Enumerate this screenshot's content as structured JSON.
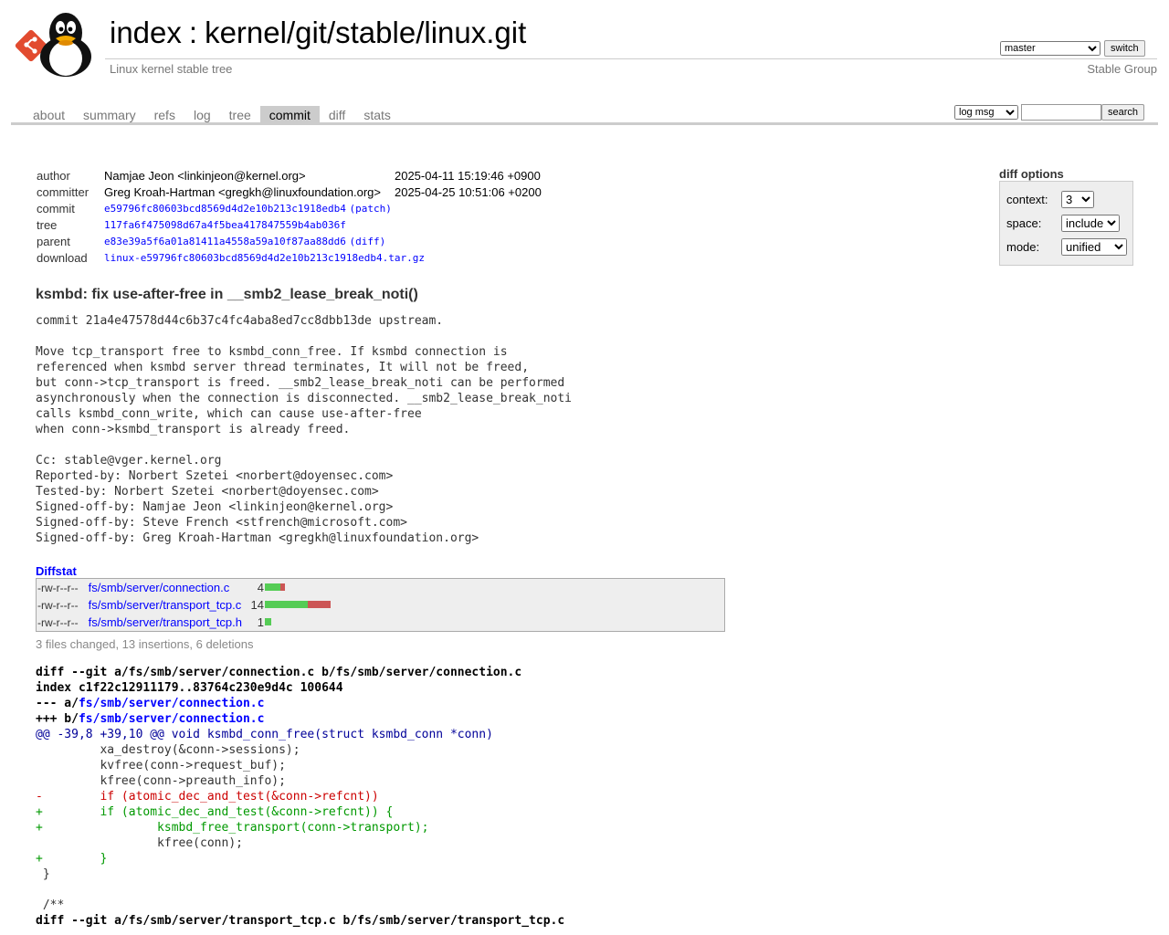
{
  "header": {
    "logo_icon": "cgit-penguin-logo",
    "title_prefix": "index",
    "title_separator": ":",
    "repo_path": "kernel/git/stable/linux.git",
    "description": "Linux kernel stable tree",
    "owner": "Stable Group",
    "branch": "master",
    "switch_label": "switch"
  },
  "tabs": [
    {
      "label": "about",
      "active": false
    },
    {
      "label": "summary",
      "active": false
    },
    {
      "label": "refs",
      "active": false
    },
    {
      "label": "log",
      "active": false
    },
    {
      "label": "tree",
      "active": false
    },
    {
      "label": "commit",
      "active": true
    },
    {
      "label": "diff",
      "active": false
    },
    {
      "label": "stats",
      "active": false
    }
  ],
  "search": {
    "scope": "log msg",
    "value": "",
    "button_label": "search"
  },
  "commit_info": {
    "author_label": "author",
    "author": "Namjae Jeon <linkinjeon@kernel.org>",
    "author_date": "2025-04-11 15:19:46 +0900",
    "committer_label": "committer",
    "committer": "Greg Kroah-Hartman <gregkh@linuxfoundation.org>",
    "committer_date": "2025-04-25 10:51:06 +0200",
    "commit_label": "commit",
    "commit_hash": "e59796fc80603bcd8569d4d2e10b213c1918edb4",
    "commit_link": "(patch)",
    "tree_label": "tree",
    "tree_hash": "117fa6f475098d67a4f5bea417847559b4ab036f",
    "parent_label": "parent",
    "parent_hash": "e83e39a5f6a01a81411a4558a59a10f87aa88dd6",
    "parent_link": "(diff)",
    "download_label": "download",
    "download_file": "linux-e59796fc80603bcd8569d4d2e10b213c1918edb4.tar.gz"
  },
  "diff_options": {
    "title": "diff options",
    "context_label": "context:",
    "context_value": "3",
    "space_label": "space:",
    "space_value": "include",
    "mode_label": "mode:",
    "mode_value": "unified"
  },
  "subject": "ksmbd: fix use-after-free in __smb2_lease_break_noti()",
  "message": "commit 21a4e47578d44c6b37c4fc4aba8ed7cc8dbb13de upstream.\n\nMove tcp_transport free to ksmbd_conn_free. If ksmbd connection is\nreferenced when ksmbd server thread terminates, It will not be freed,\nbut conn->tcp_transport is freed. __smb2_lease_break_noti can be performed\nasynchronously when the connection is disconnected. __smb2_lease_break_noti\ncalls ksmbd_conn_write, which can cause use-after-free\nwhen conn->ksmbd_transport is already freed.\n\nCc: stable@vger.kernel.org\nReported-by: Norbert Szetei <norbert@doyensec.com>\nTested-by: Norbert Szetei <norbert@doyensec.com>\nSigned-off-by: Namjae Jeon <linkinjeon@kernel.org>\nSigned-off-by: Steve French <stfrench@microsoft.com>\nSigned-off-by: Greg Kroah-Hartman <gregkh@linuxfoundation.org>",
  "diffstat": {
    "title": "Diffstat",
    "files": [
      {
        "mode": "-rw-r--r--",
        "path": "fs/smb/server/connection.c",
        "count": "4",
        "add": 3,
        "del": 1
      },
      {
        "mode": "-rw-r--r--",
        "path": "fs/smb/server/transport_tcp.c",
        "count": "14",
        "add": 9,
        "del": 5
      },
      {
        "mode": "-rw-r--r--",
        "path": "fs/smb/server/transport_tcp.h",
        "count": "1",
        "add": 1,
        "del": 0
      }
    ],
    "summary": "3 files changed, 13 insertions, 6 deletions"
  },
  "diff_lines": [
    {
      "type": "head",
      "text": "diff --git a/fs/smb/server/connection.c b/fs/smb/server/connection.c"
    },
    {
      "type": "head",
      "text": "index c1f22c12911179..83764c230e9d4c 100644"
    },
    {
      "type": "headfile",
      "prefix": "--- a/",
      "text": "fs/smb/server/connection.c"
    },
    {
      "type": "headfile",
      "prefix": "+++ b/",
      "text": "fs/smb/server/connection.c"
    },
    {
      "type": "hunk",
      "text": "@@ -39,8 +39,10 @@ void ksmbd_conn_free(struct ksmbd_conn *conn)"
    },
    {
      "type": "ctx",
      "text": " \txa_destroy(&conn->sessions);"
    },
    {
      "type": "ctx",
      "text": " \tkvfree(conn->request_buf);"
    },
    {
      "type": "ctx",
      "text": " \tkfree(conn->preauth_info);"
    },
    {
      "type": "del",
      "text": "-\tif (atomic_dec_and_test(&conn->refcnt))"
    },
    {
      "type": "add",
      "text": "+\tif (atomic_dec_and_test(&conn->refcnt)) {"
    },
    {
      "type": "add",
      "text": "+\t\tksmbd_free_transport(conn->transport);"
    },
    {
      "type": "ctx",
      "text": " \t\tkfree(conn);"
    },
    {
      "type": "add",
      "text": "+\t}"
    },
    {
      "type": "ctx",
      "text": " }"
    },
    {
      "type": "ctx",
      "text": " "
    },
    {
      "type": "ctx",
      "text": " /**"
    },
    {
      "type": "head",
      "text": "diff --git a/fs/smb/server/transport_tcp.c b/fs/smb/server/transport_tcp.c"
    }
  ]
}
